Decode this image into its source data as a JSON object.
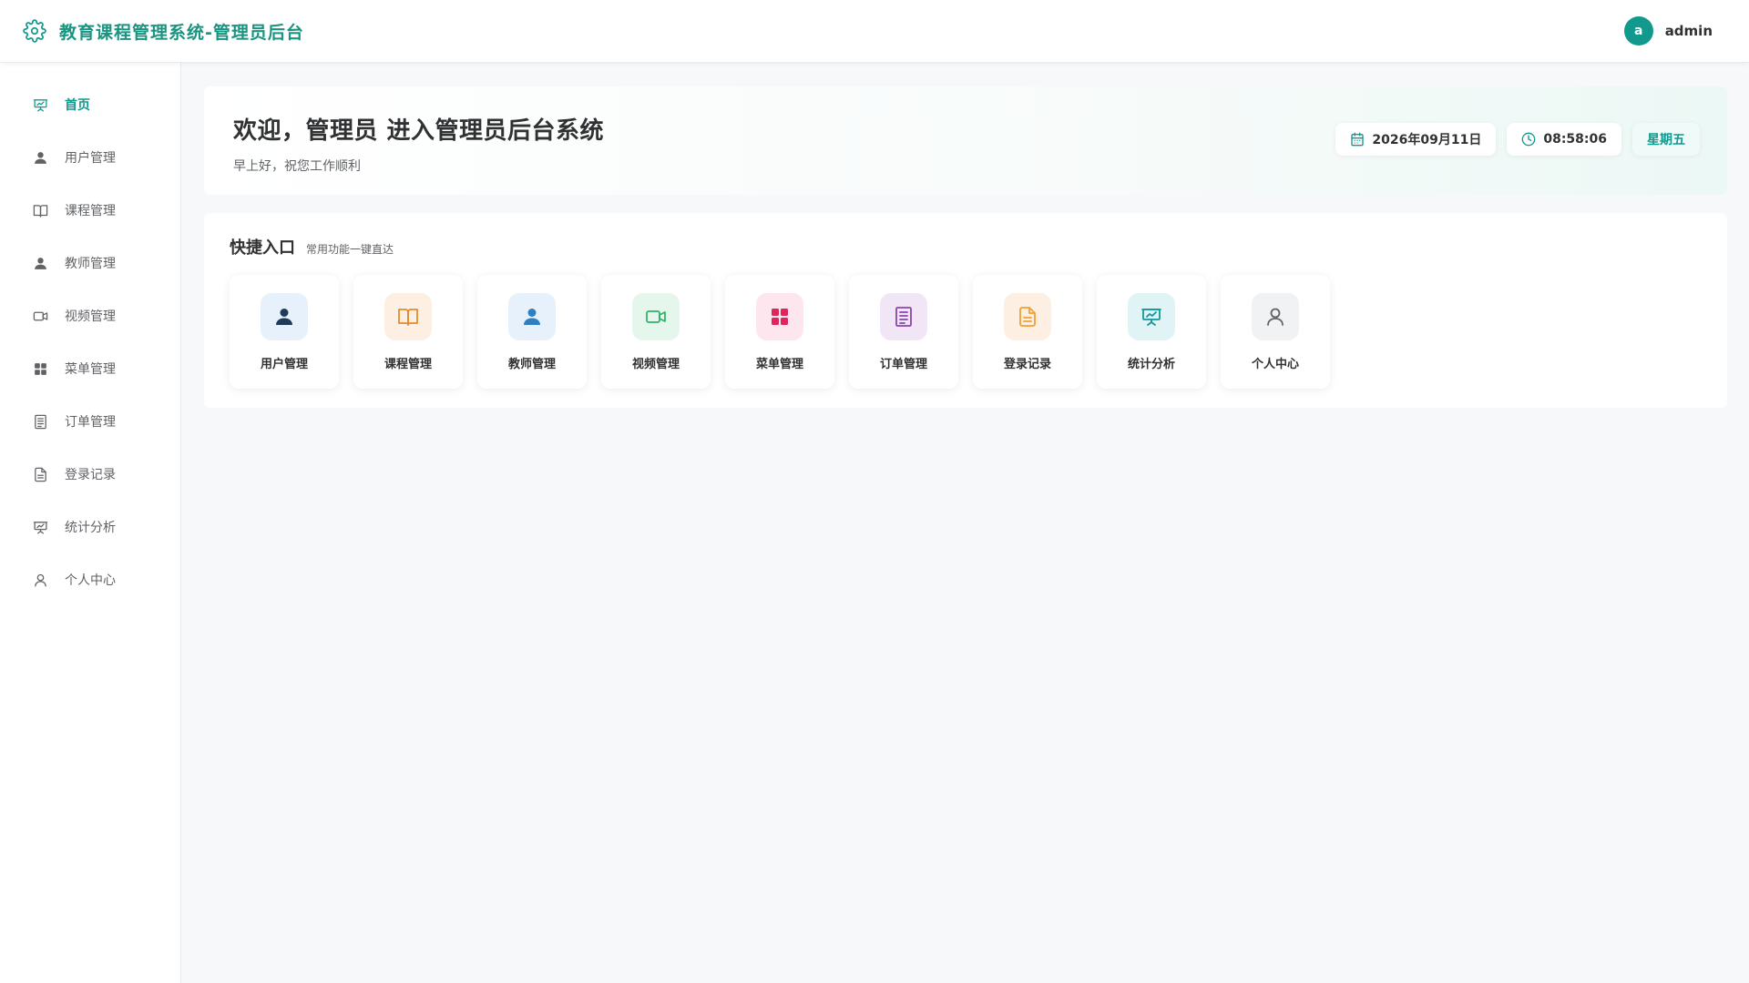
{
  "app": {
    "title": "教育课程管理系统-管理员后台",
    "brand_color": "#11998e"
  },
  "header": {
    "avatar_initial": "a",
    "username": "admin"
  },
  "sidebar": {
    "items": [
      {
        "label": "首页",
        "icon": "presentation-icon",
        "active": true
      },
      {
        "label": "用户管理",
        "icon": "user-icon"
      },
      {
        "label": "课程管理",
        "icon": "book-icon"
      },
      {
        "label": "教师管理",
        "icon": "user-icon"
      },
      {
        "label": "视频管理",
        "icon": "video-icon"
      },
      {
        "label": "菜单管理",
        "icon": "grid-icon"
      },
      {
        "label": "订单管理",
        "icon": "list-icon"
      },
      {
        "label": "登录记录",
        "icon": "document-icon"
      },
      {
        "label": "统计分析",
        "icon": "chart-board-icon"
      },
      {
        "label": "个人中心",
        "icon": "person-outline-icon"
      }
    ]
  },
  "welcome": {
    "title": "欢迎，管理员 进入管理员后台系统",
    "subtitle": "早上好，祝您工作顺利",
    "date": "2026年09月11日",
    "time": "08:58:06",
    "weekday": "星期五"
  },
  "quick": {
    "title": "快捷入口",
    "subtitle": "常用功能一键直达",
    "cards": [
      {
        "label": "用户管理",
        "icon": "user-icon",
        "bg": "#e6f1fb",
        "fg": "#1f3a5a"
      },
      {
        "label": "课程管理",
        "icon": "book-icon",
        "bg": "#fdf0e2",
        "fg": "#e68a2e"
      },
      {
        "label": "教师管理",
        "icon": "user-icon",
        "bg": "#e6f1fb",
        "fg": "#2f7fc1"
      },
      {
        "label": "视频管理",
        "icon": "video-icon",
        "bg": "#e5f6ec",
        "fg": "#32b36a"
      },
      {
        "label": "菜单管理",
        "icon": "grid-icon",
        "bg": "#fde6ee",
        "fg": "#e0245e"
      },
      {
        "label": "订单管理",
        "icon": "list-icon",
        "bg": "#f1e6f6",
        "fg": "#8e44ad"
      },
      {
        "label": "登录记录",
        "icon": "document-icon",
        "bg": "#fdf0e2",
        "fg": "#f0a030"
      },
      {
        "label": "统计分析",
        "icon": "chart-board-icon",
        "bg": "#e0f4f6",
        "fg": "#11999e"
      },
      {
        "label": "个人中心",
        "icon": "person-outline-icon",
        "bg": "#f1f2f4",
        "fg": "#606266"
      }
    ]
  }
}
